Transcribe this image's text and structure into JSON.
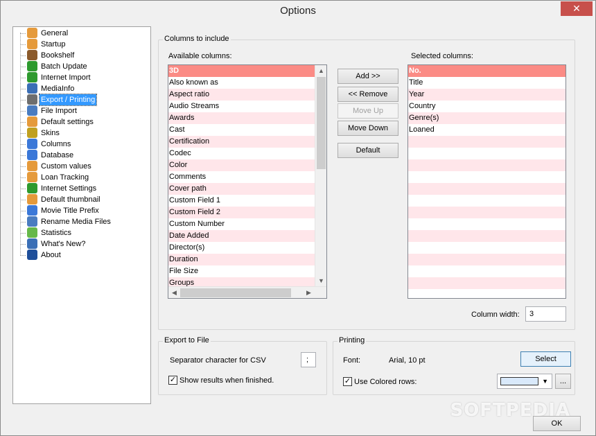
{
  "window": {
    "title": "Options",
    "close_glyph": "✕"
  },
  "tree": {
    "items": [
      {
        "label": "General",
        "icon": "person-icon",
        "color": "#e59a3b"
      },
      {
        "label": "Startup",
        "icon": "person-icon",
        "color": "#e59a3b"
      },
      {
        "label": "Bookshelf",
        "icon": "book-icon",
        "color": "#8b5a2b"
      },
      {
        "label": "Batch Update",
        "icon": "globe-icon",
        "color": "#2e9a2e"
      },
      {
        "label": "Internet Import",
        "icon": "globe-icon",
        "color": "#2e9a2e"
      },
      {
        "label": "MediaInfo",
        "icon": "gear-icon",
        "color": "#3b6fb6"
      },
      {
        "label": "Export / Printing",
        "icon": "printer-icon",
        "color": "#6e6e6e",
        "selected": true
      },
      {
        "label": "File Import",
        "icon": "document-icon",
        "color": "#4a7cc0"
      },
      {
        "label": "Default settings",
        "icon": "person-icon",
        "color": "#e59a3b"
      },
      {
        "label": "Skins",
        "icon": "brush-icon",
        "color": "#c0a020"
      },
      {
        "label": "Columns",
        "icon": "windows-icon",
        "color": "#3b78d8"
      },
      {
        "label": "Database",
        "icon": "windows-icon",
        "color": "#3b78d8"
      },
      {
        "label": "Custom values",
        "icon": "person-icon",
        "color": "#e59a3b"
      },
      {
        "label": "Loan Tracking",
        "icon": "person-icon",
        "color": "#e59a3b"
      },
      {
        "label": "Internet Settings",
        "icon": "globe-icon",
        "color": "#2e9a2e"
      },
      {
        "label": "Default thumbnail",
        "icon": "person-icon",
        "color": "#e59a3b"
      },
      {
        "label": "Movie Title Prefix",
        "icon": "windows-icon",
        "color": "#3b78d8"
      },
      {
        "label": "Rename Media Files",
        "icon": "save-icon",
        "color": "#4a7cc0"
      },
      {
        "label": "Statistics",
        "icon": "pie-chart-icon",
        "color": "#66b84a"
      },
      {
        "label": "What's New?",
        "icon": "gear-icon",
        "color": "#3b6fb6"
      },
      {
        "label": "About",
        "icon": "info-icon",
        "color": "#1f4f9a"
      }
    ]
  },
  "columns": {
    "group_title": "Columns to include",
    "available_label": "Available columns:",
    "selected_label": "Selected columns:",
    "available": [
      "3D",
      "Also known as",
      "Aspect ratio",
      "Audio Streams",
      "Awards",
      "Cast",
      "Certification",
      "Codec",
      "Color",
      "Comments",
      "Cover path",
      "Custom Field 1",
      "Custom Field 2",
      "Custom Number",
      "Date Added",
      "Director(s)",
      "Duration",
      "File Size",
      "Groups"
    ],
    "selected": [
      "No.",
      "Title",
      "Year",
      "Country",
      "Genre(s)",
      "Loaned"
    ],
    "buttons": {
      "add": "Add >>",
      "remove": "<< Remove",
      "move_up": "Move Up",
      "move_down": "Move Down",
      "default": "Default"
    },
    "width_label": "Column width:",
    "width_value": "3"
  },
  "export_file": {
    "title": "Export to File",
    "separator_label": "Separator character for CSV",
    "separator_value": ";",
    "show_results_label": "Show results when finished.",
    "show_results_checked": true
  },
  "printing": {
    "title": "Printing",
    "font_label": "Font:",
    "font_value": "Arial, 10 pt",
    "select_label": "Select",
    "colored_rows_label": "Use Colored rows:",
    "colored_rows_checked": true,
    "row_color": "#d9e9fb",
    "more_label": "..."
  },
  "footer": {
    "ok_label": "OK"
  },
  "watermark": "SOFTPEDIA",
  "colors": {
    "selection": "#3399ff",
    "row_highlight": "#fb8b85",
    "row_alt": "#ffe6ea"
  }
}
